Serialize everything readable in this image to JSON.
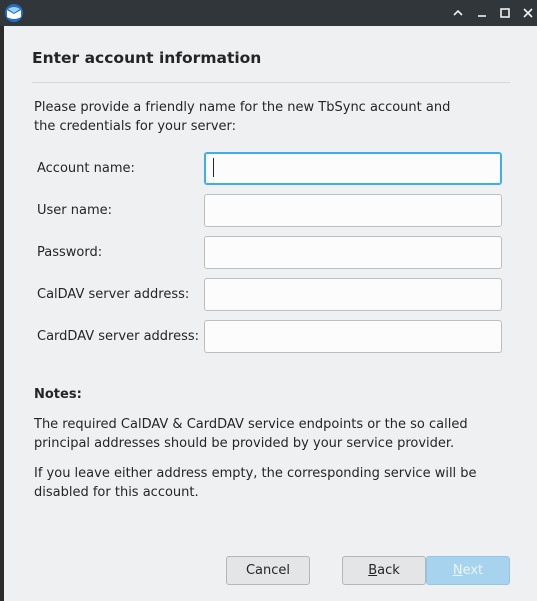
{
  "window": {
    "icon": "thunderbird-icon",
    "controls": [
      "help-icon",
      "minimize-icon",
      "maximize-icon",
      "close-icon"
    ]
  },
  "page": {
    "title": "Enter account information",
    "intro": "Please provide a friendly name for the new TbSync account and the credentials for your server:"
  },
  "fields": [
    {
      "label": "Account name:",
      "value": "",
      "focused": true
    },
    {
      "label": "User name:",
      "value": ""
    },
    {
      "label": "Password:",
      "value": ""
    },
    {
      "label": "CalDAV server address:",
      "value": ""
    },
    {
      "label": "CardDAV server address:",
      "value": ""
    }
  ],
  "notes": {
    "title": "Notes:",
    "items": [
      "The required CalDAV & CardDAV service endpoints or the so called principal addresses should be provided by your service provider.",
      "If you leave either address empty, the corresponding service will be disabled for this account."
    ]
  },
  "buttons": {
    "cancel": "Cancel",
    "back_mnemonic": "B",
    "back_rest": "ack",
    "next_mnemonic": "N",
    "next_rest": "ext"
  },
  "colors": {
    "titlebar": "#31363b",
    "dialog_bg": "#eff0f1",
    "focus_accent": "#3daee9",
    "next_disabled": "#a8d3ee"
  }
}
